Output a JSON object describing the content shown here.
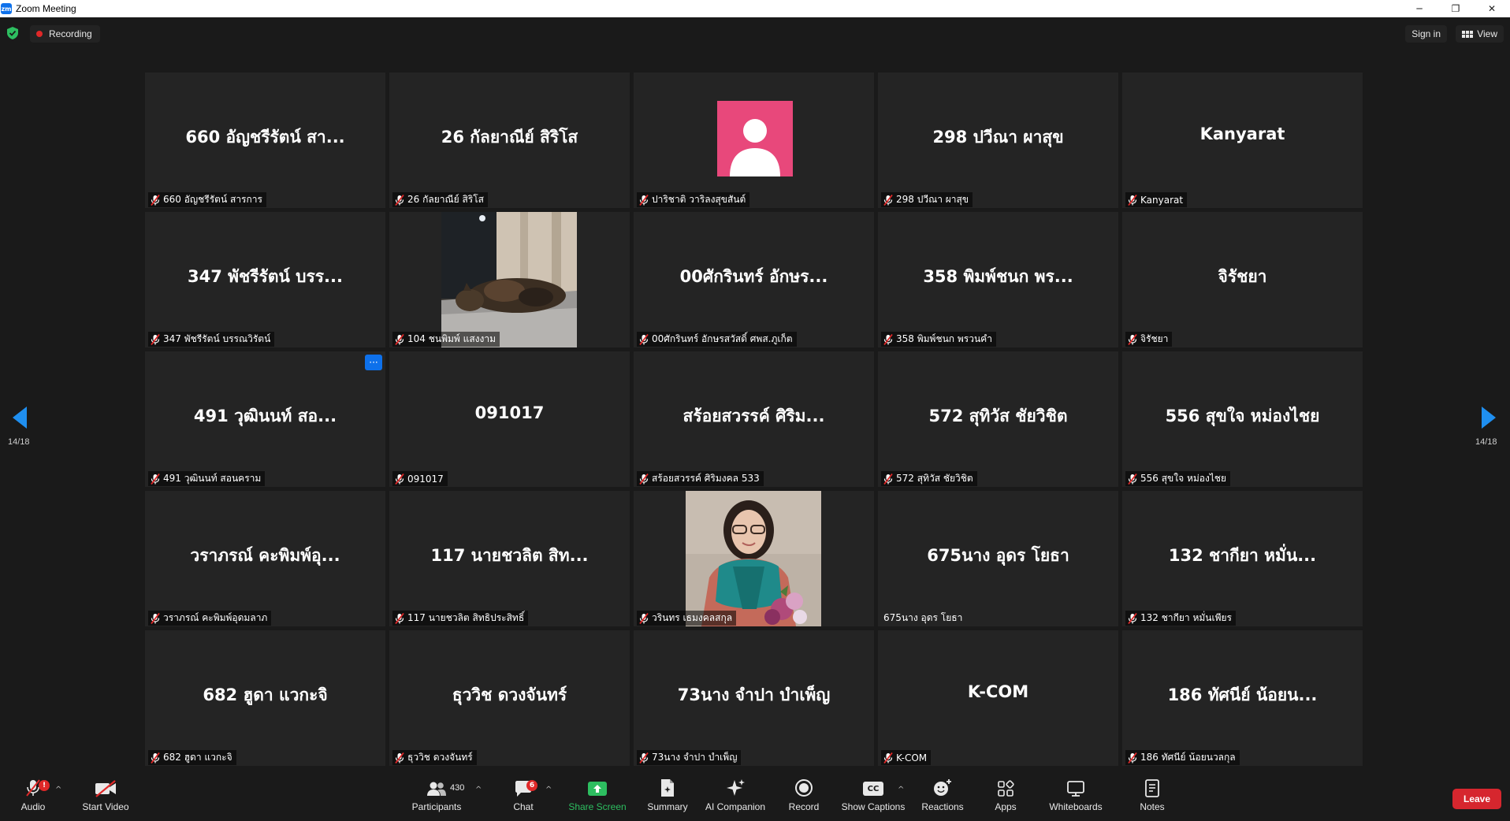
{
  "window": {
    "app_icon_text": "zm",
    "title": "Zoom Meeting",
    "min": "─",
    "restore": "❐",
    "close": "✕"
  },
  "topbar": {
    "recording_label": "Recording",
    "signin_label": "Sign in",
    "view_label": "View"
  },
  "tiles": [
    {
      "big": "660 อัญชรีรัตน์ สา...",
      "tag": "660 อัญชรีรัตน์ สารการ",
      "muted": true,
      "kind": "name"
    },
    {
      "big": "26 กัลยาณีย์ สิริโส",
      "tag": "26 กัลยาณีย์ สิริโส",
      "muted": true,
      "kind": "name"
    },
    {
      "big": "",
      "tag": "ปาริชาติ วาริลงสุขสันต์",
      "muted": true,
      "kind": "avatar"
    },
    {
      "big": "298 ปวีณา ผาสุข",
      "tag": "298 ปวีณา ผาสุข",
      "muted": true,
      "kind": "name"
    },
    {
      "big": "Kanyarat",
      "tag": "Kanyarat",
      "muted": true,
      "kind": "name"
    },
    {
      "big": "347 พัชรีรัตน์ บรร...",
      "tag": "347 พัชรีรัตน์ บรรณวิรัตน์",
      "muted": true,
      "kind": "name"
    },
    {
      "big": "",
      "tag": "104 ชนพิมพ์ แสงงาม",
      "muted": true,
      "kind": "video-cat"
    },
    {
      "big": "00ศักรินทร์ อักษร...",
      "tag": "00ศักรินทร์ อักษรสวัสดิ์ ศพส.ภูเก็ต",
      "muted": true,
      "kind": "name"
    },
    {
      "big": "358 พิมพ์ชนก พร...",
      "tag": "358 พิมพ์ชนก พรวนคำ",
      "muted": true,
      "kind": "name"
    },
    {
      "big": "จิรัชยา",
      "tag": "จิรัชยา",
      "muted": true,
      "kind": "name"
    },
    {
      "big": "491 วุฒินนท์ สอ...",
      "tag": "491 วุฒินนท์ สอนคราม",
      "muted": true,
      "kind": "name",
      "more": "···"
    },
    {
      "big": "091017",
      "tag": "091017",
      "muted": true,
      "kind": "name"
    },
    {
      "big": "สร้อยสวรรค์ ศิริม...",
      "tag": "สร้อยสวรรค์ ศิริมงคล 533",
      "muted": true,
      "kind": "name"
    },
    {
      "big": "572 สุทิวัส ชัยวิชิต",
      "tag": "572 สุทิวัส ชัยวิชิต",
      "muted": true,
      "kind": "name"
    },
    {
      "big": "556 สุขใจ หม่องไชย",
      "tag": "556 สุขใจ หม่องไชย",
      "muted": true,
      "kind": "name"
    },
    {
      "big": "วราภรณ์ คะพิมพ์อุ...",
      "tag": "วราภรณ์ คะพิมพ์อุดมลาภ",
      "muted": true,
      "kind": "name"
    },
    {
      "big": "117 นายชวลิต สิท...",
      "tag": "117 นายชวลิต สิทธิประสิทธิ์",
      "muted": true,
      "kind": "name"
    },
    {
      "big": "",
      "tag": "วรินทร เธมงคลสกุล",
      "muted": true,
      "kind": "video-woman"
    },
    {
      "big": "675นาง อุดร โยธา",
      "tag": "675นาง อุดร โยธา",
      "muted": false,
      "kind": "name"
    },
    {
      "big": "132 ชากียา หมั่น...",
      "tag": "132 ชากียา หมั่นเพียร",
      "muted": true,
      "kind": "name"
    },
    {
      "big": "682 ฮูดา แวกะจิ",
      "tag": "682 ฮูดา แวกะจิ",
      "muted": true,
      "kind": "name"
    },
    {
      "big": "ธุววิช ดวงจันทร์",
      "tag": "ธุววิช ดวงจันทร์",
      "muted": true,
      "kind": "name"
    },
    {
      "big": "73นาง จำปา บำเพ็ญ",
      "tag": "73นาง จำปา บำเพ็ญ",
      "muted": true,
      "kind": "name"
    },
    {
      "big": "K-COM",
      "tag": "K-COM",
      "muted": true,
      "kind": "name"
    },
    {
      "big": "186 ทัศนีย์ น้อยน...",
      "tag": "186 ทัศนีย์ น้อยนวลกุล",
      "muted": true,
      "kind": "name"
    }
  ],
  "pagination": {
    "left_label": "14/18",
    "right_label": "14/18"
  },
  "toolbar": {
    "audio": "Audio",
    "audio_badge": "!",
    "start_video": "Start Video",
    "participants": "Participants",
    "participants_count": "430",
    "chat": "Chat",
    "chat_badge": "6",
    "share_screen": "Share Screen",
    "summary": "Summary",
    "ai_companion": "AI Companion",
    "record": "Record",
    "show_captions": "Show Captions",
    "captions_icon_text": "CC",
    "reactions": "Reactions",
    "apps": "Apps",
    "whiteboards": "Whiteboards",
    "notes": "Notes",
    "leave": "Leave",
    "caret": "^"
  },
  "colors": {
    "accent_blue": "#0e71eb",
    "share_green": "#2dbe60",
    "leave_red": "#d6262e",
    "muted_red": "#e02828",
    "avatar_pink": "#e8487b"
  }
}
